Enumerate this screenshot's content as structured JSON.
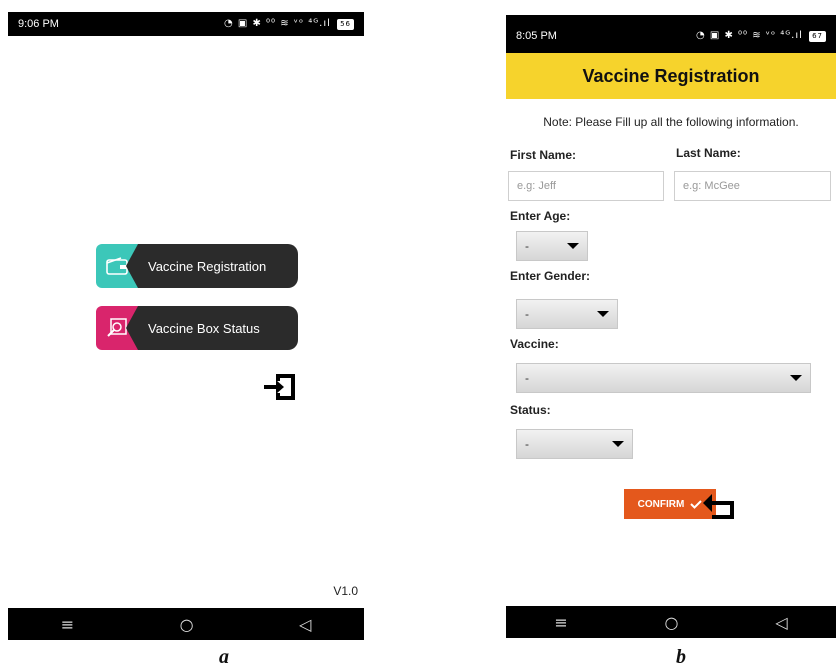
{
  "phone_a": {
    "status": {
      "time": "9:06 PM",
      "icons": "◔ ▣ ✱ ⁰⁰ ≋ ᵛᵒ ⁴ᴳ.ıl",
      "battery": "56"
    },
    "buttons": {
      "registration_label": "Vaccine Registration",
      "box_status_label": "Vaccine Box Status"
    },
    "version": "V1.0"
  },
  "phone_b": {
    "status": {
      "time": "8:05 PM",
      "icons": "◔ ▣ ✱ ⁰⁰ ≋ ᵛᵒ ⁴ᴳ.ıl",
      "battery": "67"
    },
    "title": "Vaccine Registration",
    "note": "Note: Please Fill up all the following information.",
    "first_name": {
      "label": "First Name:",
      "placeholder": "e.g: Jeff"
    },
    "last_name": {
      "label": "Last Name:",
      "placeholder": "e.g: McGee"
    },
    "age": {
      "label": "Enter Age:",
      "value": "-"
    },
    "gender": {
      "label": "Enter Gender:",
      "value": "-"
    },
    "vaccine": {
      "label": "Vaccine:",
      "value": "-"
    },
    "status_field": {
      "label": "Status:",
      "value": "-"
    },
    "confirm_label": "CONFIRM"
  },
  "nav": {
    "menu": "≡",
    "home": "○",
    "back": "◁"
  },
  "captions": {
    "a": "a",
    "b": "b"
  },
  "colors": {
    "header_yellow": "#f6d32c",
    "confirm_orange": "#e4581c",
    "teal": "#3cc7b9",
    "magenta": "#d9256c"
  },
  "icons": {
    "registration": "wallet-icon",
    "box_status": "search-doc-icon",
    "logout": "logout-icon",
    "back": "return-icon"
  }
}
